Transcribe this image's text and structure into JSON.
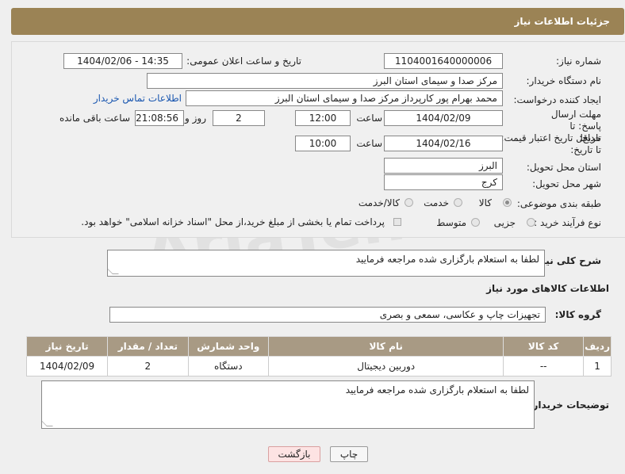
{
  "header": {
    "title": "جزئیات اطلاعات نیاز"
  },
  "form": {
    "need_number_label": "شماره نیاز:",
    "need_number": "1104001640000006",
    "announce_label": "تاریخ و ساعت اعلان عمومی:",
    "announce_value": "1404/02/06 - 14:35",
    "buyer_org_label": "نام دستگاه خریدار:",
    "buyer_org": "مرکز صدا و سیمای استان البرز",
    "creator_label": "ایجاد کننده درخواست:",
    "creator": "محمد بهرام پور کارپرداز مرکز صدا و سیمای استان البرز",
    "contact_link": "اطلاعات تماس خریدار",
    "deadline_label": "مهلت ارسال پاسخ: تا تاریخ:",
    "deadline_date": "1404/02/09",
    "time_label": "ساعت",
    "deadline_time": "12:00",
    "days_value": "2",
    "days_label": "روز و",
    "remaining_time": "21:08:56",
    "remaining_label": "ساعت باقی مانده",
    "validity_label": "حداقل تاریخ اعتبار قیمت: تا تاریخ:",
    "validity_date": "1404/02/16",
    "validity_time": "10:00",
    "province_label": "استان محل تحویل:",
    "province": "البرز",
    "city_label": "شهر محل تحویل:",
    "city": "کرج",
    "category_label": "طبقه بندی موضوعی:",
    "category_options": [
      "کالا",
      "خدمت",
      "کالا/خدمت"
    ],
    "process_label": "نوع فرآیند خرید :",
    "process_options": [
      "جزیی",
      "متوسط"
    ],
    "payment_note": "پرداخت تمام یا بخشی از مبلغ خرید،از محل \"اسناد خزانه اسلامی\" خواهد بود."
  },
  "description": {
    "label": "شرح کلی نیاز:",
    "text": "لطفا به استعلام بارگزاری شده مراجعه فرمایید"
  },
  "goods": {
    "section_title": "اطلاعات کالاهای مورد نیاز",
    "group_label": "گروه کالا:",
    "group_value": "تجهیزات چاپ و عکاسی، سمعی و بصری",
    "columns": [
      "ردیف",
      "کد کالا",
      "نام کالا",
      "واحد شمارش",
      "تعداد / مقدار",
      "تاریخ نیاز"
    ],
    "rows": [
      [
        "1",
        "--",
        "دوربین دیجیتال",
        "دستگاه",
        "2",
        "1404/02/09"
      ]
    ]
  },
  "buyer_notes": {
    "label": "توضیحات خریدار:",
    "text": "لطفا به استعلام بارگزاری شده مراجعه فرمایید"
  },
  "buttons": {
    "print": "چاپ",
    "back": "بازگشت"
  },
  "watermark": "AriaTender.neT"
}
